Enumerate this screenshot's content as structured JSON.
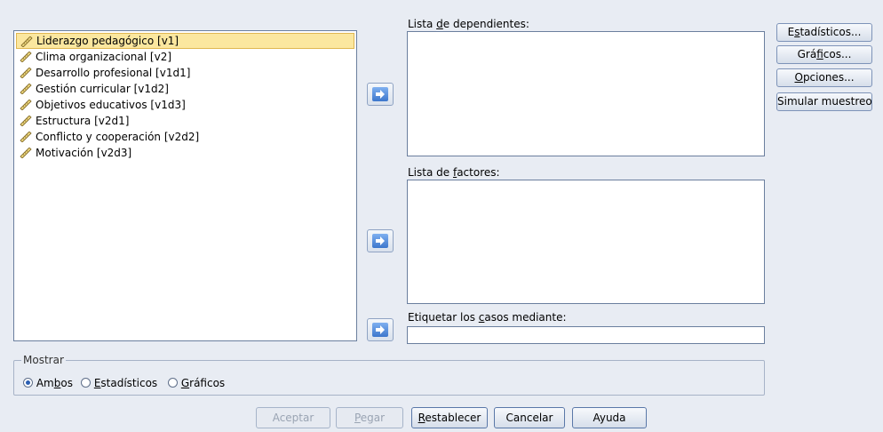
{
  "variables": [
    {
      "label": "Liderazgo pedagógico [v1]",
      "selected": true
    },
    {
      "label": "Clima organizacional [v2]",
      "selected": false
    },
    {
      "label": "Desarrollo profesional [v1d1]",
      "selected": false
    },
    {
      "label": "Gestión curricular [v1d2]",
      "selected": false
    },
    {
      "label": "Objetivos educativos [v1d3]",
      "selected": false
    },
    {
      "label": "Estructura [v2d1]",
      "selected": false
    },
    {
      "label": "Conflicto y cooperación [v2d2]",
      "selected": false
    },
    {
      "label": "Motivación [v2d3]",
      "selected": false
    }
  ],
  "dependents": {
    "pre": "Lista ",
    "mn": "d",
    "post": "e dependientes:"
  },
  "factors": {
    "pre": "Lista de ",
    "mn": "f",
    "post": "actores:"
  },
  "label_cases": {
    "pre": "Etiquetar los ",
    "mn": "c",
    "post": "asos mediante:"
  },
  "side_buttons": {
    "statistics": {
      "pre": "E",
      "mn": "s",
      "post": "tadísticos..."
    },
    "plots": {
      "pre": "Grá",
      "mn": "f",
      "post": "icos..."
    },
    "options": {
      "pre": "",
      "mn": "O",
      "post": "pciones..."
    },
    "bootstrap": {
      "pre": "Simular muestreo...",
      "mn": "",
      "post": ""
    }
  },
  "display": {
    "title": "Mostrar",
    "both": {
      "pre": "Am",
      "mn": "b",
      "post": "os",
      "selected": true
    },
    "stats": {
      "pre": "",
      "mn": "E",
      "post": "stadísticos",
      "selected": false
    },
    "plots": {
      "pre": "",
      "mn": "G",
      "post": "ráficos",
      "selected": false
    }
  },
  "bottom_buttons": {
    "ok": "Aceptar",
    "paste": {
      "pre": "",
      "mn": "P",
      "post": "egar"
    },
    "reset": {
      "pre": "",
      "mn": "R",
      "post": "establecer"
    },
    "cancel": "Cancelar",
    "help": "Ayuda"
  },
  "colors": {
    "background": "#e8ecf3",
    "selection": "#fbe79f",
    "arrow": "#3d77cc"
  },
  "icons": {
    "variable": "ruler-icon",
    "move": "arrow-right-icon"
  }
}
